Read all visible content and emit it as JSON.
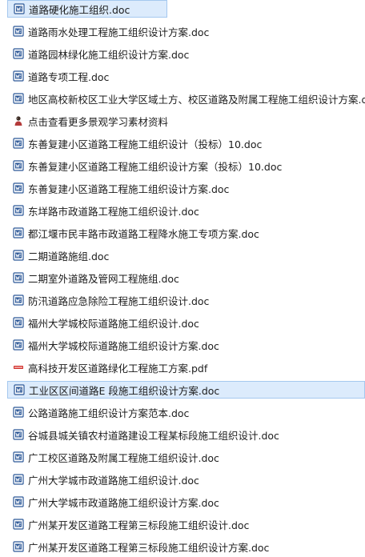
{
  "files": [
    {
      "name": "道路硬化施工组织.doc",
      "type": "doc"
    },
    {
      "name": "道路雨水处理工程施工组织设计方案.doc",
      "type": "doc"
    },
    {
      "name": "道路园林绿化施工组织设计方案.doc",
      "type": "doc"
    },
    {
      "name": "道路专项工程.doc",
      "type": "doc"
    },
    {
      "name": "地区高校新校区工业大学区域土方、校区道路及附属工程施工组织设计方案.doc",
      "type": "doc"
    },
    {
      "name": "点击查看更多景观学习素材资料",
      "type": "link"
    },
    {
      "name": "东善复建小区道路工程施工组织设计（投标）10.doc",
      "type": "doc"
    },
    {
      "name": "东善复建小区道路工程施工组织设计方案（投标）10.doc",
      "type": "doc"
    },
    {
      "name": "东善复建小区道路工程施工组织设计方案.doc",
      "type": "doc"
    },
    {
      "name": "东垟路市政道路工程施工组织设计.doc",
      "type": "doc"
    },
    {
      "name": "都江堰市民丰路市政道路工程降水施工专项方案.doc",
      "type": "doc"
    },
    {
      "name": "二期道路施组.doc",
      "type": "doc"
    },
    {
      "name": "二期室外道路及管网工程施组.doc",
      "type": "doc"
    },
    {
      "name": "防汛道路应急除险工程施工组织设计.doc",
      "type": "doc"
    },
    {
      "name": "福州大学城校际道路施工组织设计.doc",
      "type": "doc"
    },
    {
      "name": "福州大学城校际道路施工组织设计方案.doc",
      "type": "doc"
    },
    {
      "name": "高科技开发区道路绿化工程施工方案.pdf",
      "type": "pdf"
    },
    {
      "name": "工业区区间道路E 段施工组织设计方案.doc",
      "type": "doc"
    },
    {
      "name": "公路道路施工组织设计方案范本.doc",
      "type": "doc"
    },
    {
      "name": "谷城县城关镇农村道路建设工程某标段施工组织设计.doc",
      "type": "doc"
    },
    {
      "name": "广工校区道路及附属工程施工组织设计.doc",
      "type": "doc"
    },
    {
      "name": "广州大学城市政道路施工组织设计.doc",
      "type": "doc"
    },
    {
      "name": "广州大学城市政道路施工组织设计方案.doc",
      "type": "doc"
    },
    {
      "name": "广州某开发区道路工程第三标段施工组织设计.doc",
      "type": "doc"
    },
    {
      "name": "广州某开发区道路工程第三标段施工组织设计方案.doc",
      "type": "doc"
    }
  ],
  "icons": {
    "doc": "word-document-icon",
    "pdf": "pdf-document-icon",
    "link": "shortcut-link-icon"
  },
  "colors": {
    "doc_icon": "#2b5797",
    "pdf_icon": "#d0312d",
    "selection_bg": "#dcebfc",
    "selection_border": "#a5c8ef"
  }
}
